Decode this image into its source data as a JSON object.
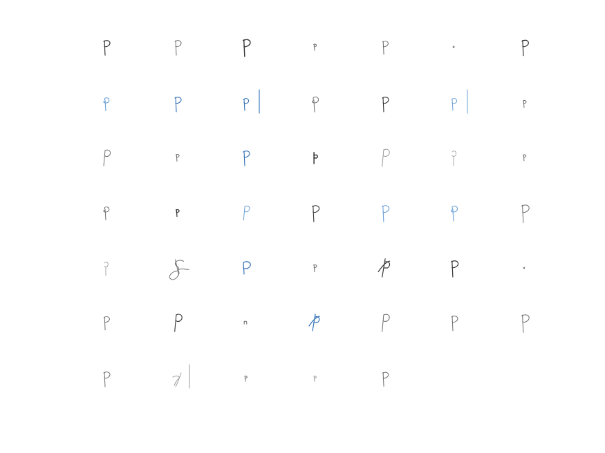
{
  "figure": {
    "columns": 7,
    "rows": 7,
    "ink_colors": {
      "dark": "#333333",
      "gray": "#6b6b6b",
      "light": "#9a9a9a",
      "blue": "#2f6fb7",
      "lightblue": "#6a9fd6"
    },
    "samples": [
      {
        "row": 0,
        "col": 0,
        "style": "p",
        "ink": "dark",
        "scale": 1.0,
        "stroke": 1.2
      },
      {
        "row": 0,
        "col": 1,
        "style": "p",
        "ink": "gray",
        "scale": 1.0,
        "stroke": 1.0
      },
      {
        "row": 0,
        "col": 2,
        "style": "p",
        "ink": "dark",
        "scale": 1.15,
        "stroke": 1.4
      },
      {
        "row": 0,
        "col": 3,
        "style": "p-small",
        "ink": "gray",
        "scale": 0.7,
        "stroke": 1.0
      },
      {
        "row": 0,
        "col": 4,
        "style": "p",
        "ink": "gray",
        "scale": 0.9,
        "stroke": 1.0
      },
      {
        "row": 0,
        "col": 5,
        "style": "dot",
        "ink": "gray",
        "scale": 0.5,
        "stroke": 1.0
      },
      {
        "row": 0,
        "col": 6,
        "style": "p",
        "ink": "dark",
        "scale": 1.05,
        "stroke": 1.2
      },
      {
        "row": 1,
        "col": 0,
        "style": "p-loop",
        "ink": "lightblue",
        "scale": 0.95,
        "stroke": 1.1
      },
      {
        "row": 1,
        "col": 1,
        "style": "p",
        "ink": "blue",
        "scale": 1.0,
        "stroke": 1.1
      },
      {
        "row": 1,
        "col": 2,
        "style": "p-bar",
        "ink": "blue",
        "scale": 1.0,
        "stroke": 1.1
      },
      {
        "row": 1,
        "col": 3,
        "style": "p-loop",
        "ink": "gray",
        "scale": 1.1,
        "stroke": 1.0
      },
      {
        "row": 1,
        "col": 4,
        "style": "p",
        "ink": "dark",
        "scale": 1.0,
        "stroke": 1.1
      },
      {
        "row": 1,
        "col": 5,
        "style": "p-bar",
        "ink": "lightblue",
        "scale": 1.0,
        "stroke": 1.0
      },
      {
        "row": 1,
        "col": 6,
        "style": "p-small",
        "ink": "gray",
        "scale": 0.8,
        "stroke": 1.0
      },
      {
        "row": 2,
        "col": 0,
        "style": "p-open",
        "ink": "gray",
        "scale": 1.0,
        "stroke": 1.0
      },
      {
        "row": 2,
        "col": 1,
        "style": "p-small",
        "ink": "gray",
        "scale": 0.8,
        "stroke": 1.0
      },
      {
        "row": 2,
        "col": 2,
        "style": "p",
        "ink": "blue",
        "scale": 1.0,
        "stroke": 1.1
      },
      {
        "row": 2,
        "col": 3,
        "style": "p-bold",
        "ink": "dark",
        "scale": 0.9,
        "stroke": 1.5
      },
      {
        "row": 2,
        "col": 4,
        "style": "p-open",
        "ink": "light",
        "scale": 1.1,
        "stroke": 1.0
      },
      {
        "row": 2,
        "col": 5,
        "style": "p-faint",
        "ink": "light",
        "scale": 1.0,
        "stroke": 0.8
      },
      {
        "row": 2,
        "col": 6,
        "style": "p-small",
        "ink": "gray",
        "scale": 0.7,
        "stroke": 1.0
      },
      {
        "row": 3,
        "col": 0,
        "style": "p-loop",
        "ink": "gray",
        "scale": 0.95,
        "stroke": 1.0
      },
      {
        "row": 3,
        "col": 1,
        "style": "p-small",
        "ink": "dark",
        "scale": 0.8,
        "stroke": 1.2
      },
      {
        "row": 3,
        "col": 2,
        "style": "p-open",
        "ink": "lightblue",
        "scale": 0.9,
        "stroke": 1.0
      },
      {
        "row": 3,
        "col": 3,
        "style": "p",
        "ink": "dark",
        "scale": 1.1,
        "stroke": 1.1
      },
      {
        "row": 3,
        "col": 4,
        "style": "p",
        "ink": "lightblue",
        "scale": 1.1,
        "stroke": 1.1
      },
      {
        "row": 3,
        "col": 5,
        "style": "p-loop",
        "ink": "lightblue",
        "scale": 1.1,
        "stroke": 1.1
      },
      {
        "row": 3,
        "col": 6,
        "style": "p",
        "ink": "gray",
        "scale": 1.2,
        "stroke": 1.0
      },
      {
        "row": 4,
        "col": 0,
        "style": "p-faint",
        "ink": "light",
        "scale": 0.9,
        "stroke": 0.9
      },
      {
        "row": 4,
        "col": 1,
        "style": "scrawl",
        "ink": "gray",
        "scale": 1.2,
        "stroke": 1.0
      },
      {
        "row": 4,
        "col": 2,
        "style": "p-round",
        "ink": "blue",
        "scale": 1.0,
        "stroke": 1.2
      },
      {
        "row": 4,
        "col": 3,
        "style": "p-small",
        "ink": "gray",
        "scale": 0.8,
        "stroke": 1.0
      },
      {
        "row": 4,
        "col": 4,
        "style": "p-cross",
        "ink": "dark",
        "scale": 1.1,
        "stroke": 1.2
      },
      {
        "row": 4,
        "col": 5,
        "style": "p",
        "ink": "dark",
        "scale": 1.1,
        "stroke": 1.2
      },
      {
        "row": 4,
        "col": 6,
        "style": "dot",
        "ink": "gray",
        "scale": 0.4,
        "stroke": 1.0
      },
      {
        "row": 5,
        "col": 0,
        "style": "p",
        "ink": "gray",
        "scale": 0.9,
        "stroke": 1.0
      },
      {
        "row": 5,
        "col": 1,
        "style": "p-open",
        "ink": "dark",
        "scale": 1.1,
        "stroke": 1.1
      },
      {
        "row": 5,
        "col": 2,
        "style": "n-small",
        "ink": "gray",
        "scale": 0.6,
        "stroke": 1.0
      },
      {
        "row": 5,
        "col": 3,
        "style": "p-cross",
        "ink": "blue",
        "scale": 1.0,
        "stroke": 1.2
      },
      {
        "row": 5,
        "col": 4,
        "style": "p-open",
        "ink": "gray",
        "scale": 1.1,
        "stroke": 1.0
      },
      {
        "row": 5,
        "col": 5,
        "style": "p",
        "ink": "gray",
        "scale": 1.0,
        "stroke": 1.0
      },
      {
        "row": 5,
        "col": 6,
        "style": "p",
        "ink": "gray",
        "scale": 1.2,
        "stroke": 1.0
      },
      {
        "row": 6,
        "col": 0,
        "style": "p",
        "ink": "gray",
        "scale": 1.0,
        "stroke": 1.0
      },
      {
        "row": 6,
        "col": 1,
        "style": "scrawl-bar",
        "ink": "light",
        "scale": 1.0,
        "stroke": 1.0
      },
      {
        "row": 6,
        "col": 2,
        "style": "p-small",
        "ink": "gray",
        "scale": 0.6,
        "stroke": 1.0
      },
      {
        "row": 6,
        "col": 3,
        "style": "p-small",
        "ink": "light",
        "scale": 0.6,
        "stroke": 1.0
      },
      {
        "row": 6,
        "col": 4,
        "style": "p",
        "ink": "gray",
        "scale": 0.95,
        "stroke": 1.0
      }
    ]
  }
}
